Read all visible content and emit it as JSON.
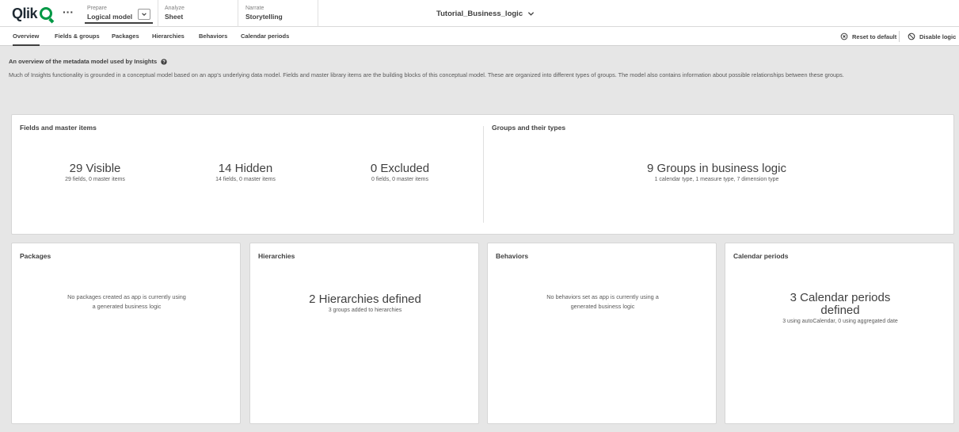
{
  "header": {
    "logo_text": "Qlik",
    "more_label": "···",
    "stages": [
      {
        "label": "Prepare",
        "value": "Logical model"
      },
      {
        "label": "Analyze",
        "value": "Sheet"
      },
      {
        "label": "Narrate",
        "value": "Storytelling"
      }
    ],
    "app_title": "Tutorial_Business_logic"
  },
  "tabs": [
    {
      "label": "Overview",
      "active": true
    },
    {
      "label": "Fields & groups"
    },
    {
      "label": "Packages"
    },
    {
      "label": "Hierarchies"
    },
    {
      "label": "Behaviors"
    },
    {
      "label": "Calendar periods"
    }
  ],
  "actions": {
    "reset_label": "Reset to default",
    "disable_label": "Disable logic"
  },
  "overview": {
    "title": "An overview of the metadata model used by Insights",
    "description": "Much of Insights functionality is grounded in a conceptual model based on an app's underlying data model. Fields and master library items are the building blocks of this conceptual model. These are organized into different types of groups. The model also contains information about possible relationships between these groups."
  },
  "fields_card": {
    "title": "Fields and master items",
    "visible": {
      "big": "29 Visible",
      "small": "29 fields, 0 master items"
    },
    "hidden": {
      "big": "14 Hidden",
      "small": "14 fields, 0 master items"
    },
    "excluded": {
      "big": "0 Excluded",
      "small": "0 fields, 0 master items"
    }
  },
  "groups_card": {
    "title": "Groups and their types",
    "big": "9 Groups in business logic",
    "small": "1 calendar type, 1 measure type, 7 dimension type"
  },
  "packages_card": {
    "title": "Packages",
    "message": "No packages created as app is currently using a generated business logic"
  },
  "hierarchies_card": {
    "title": "Hierarchies",
    "big": "2 Hierarchies defined",
    "small": "3 groups added to hierarchies"
  },
  "behaviors_card": {
    "title": "Behaviors",
    "message": "No behaviors set as app is currently using a generated business logic"
  },
  "calendar_card": {
    "title": "Calendar periods",
    "big": "3 Calendar periods defined",
    "small": "3 using autoCalendar, 0 using aggregated date"
  },
  "colors": {
    "brand_green": "#009845",
    "background": "#e6e6e6",
    "card": "#ffffff",
    "text": "#404040"
  }
}
